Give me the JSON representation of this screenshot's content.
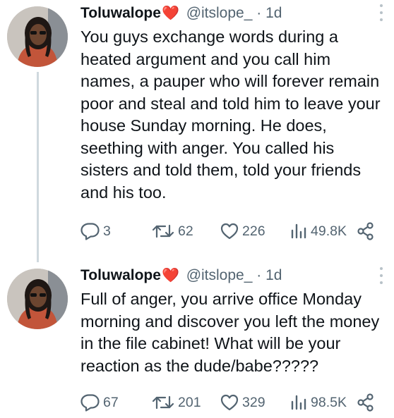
{
  "tweets": [
    {
      "author_name": "Toluwalope",
      "name_emoji": "❤️",
      "handle": "@itslope_",
      "dot": "·",
      "time": "1d",
      "text": "You guys exchange words during a heated argument and you call him names, a pauper who will forever remain poor and steal and told him to leave your house Sunday morning.  He does, seething with anger.  You called his sisters and told them, told your friends and his too.",
      "replies": "3",
      "retweets": "62",
      "likes": "226",
      "views": "49.8K"
    },
    {
      "author_name": "Toluwalope",
      "name_emoji": "❤️",
      "handle": "@itslope_",
      "dot": "·",
      "time": "1d",
      "text": "Full of anger, you arrive office Monday morning and discover you left the money in the file cabinet!  What will be your reaction as the dude/babe?????",
      "replies": "67",
      "retweets": "201",
      "likes": "329",
      "views": "98.5K"
    }
  ],
  "icons": {
    "reply": "reply-icon",
    "retweet": "retweet-icon",
    "like": "like-icon",
    "views": "views-icon",
    "share": "share-icon",
    "more": "more-options-icon"
  },
  "colors": {
    "text": "#0f1419",
    "secondary": "#536471",
    "heart": "#e0245e",
    "thread_line": "#cfd9de"
  }
}
